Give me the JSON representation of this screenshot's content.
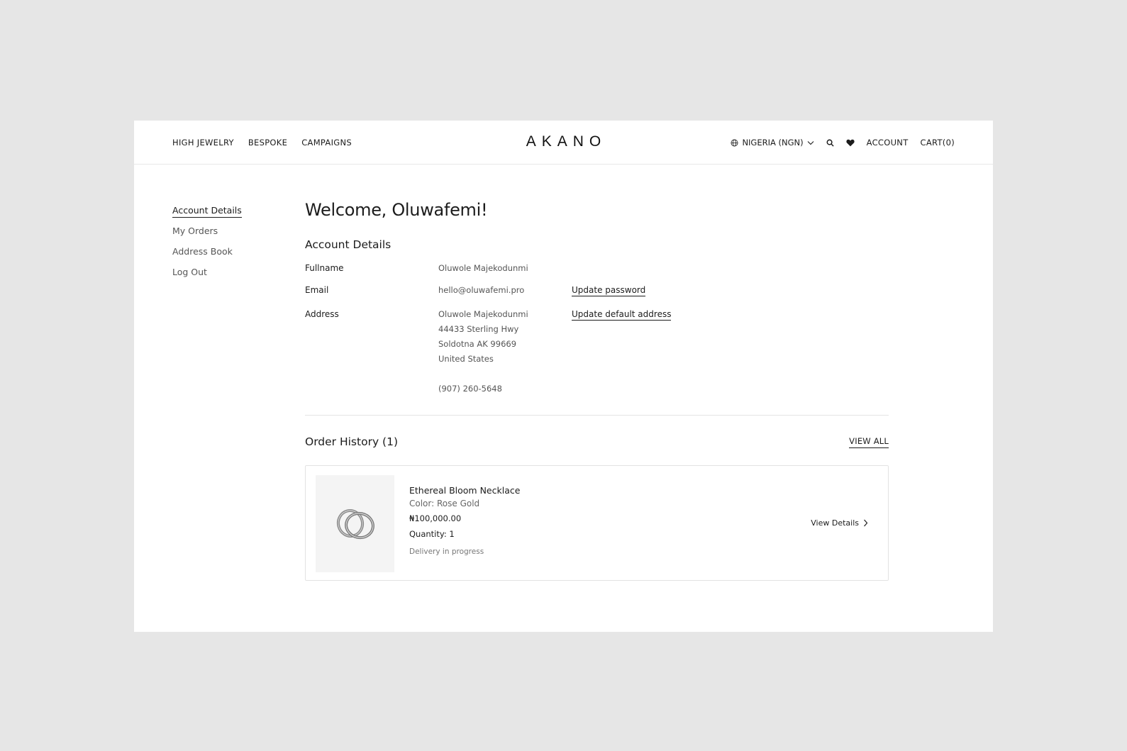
{
  "header": {
    "nav_left": [
      "HIGH JEWELRY",
      "BESPOKE",
      "CAMPAIGNS"
    ],
    "logo": "AKANO",
    "region": "NIGERIA (NGN)",
    "account": "ACCOUNT",
    "cart": "CART(0)"
  },
  "sidebar": {
    "items": [
      {
        "label": "Account Details"
      },
      {
        "label": "My Orders"
      },
      {
        "label": "Address Book"
      },
      {
        "label": "Log Out"
      }
    ]
  },
  "main": {
    "welcome": "Welcome, Oluwafemi!",
    "account_details_title": "Account Details",
    "fullname_label": "Fullname",
    "fullname_value": "Oluwole Majekodunmi",
    "email_label": "Email",
    "email_value": "hello@oluwafemi.pro",
    "update_password": "Update password",
    "address_label": "Address",
    "address_lines": [
      "Oluwole Majekodunmi",
      "44433 Sterling Hwy",
      "Soldotna AK 99669",
      "United States"
    ],
    "phone": "(907) 260-5648",
    "update_address": "Update default address",
    "order_history_title": "Order History (1)",
    "view_all": "VIEW ALL"
  },
  "order": {
    "name": "Ethereal Bloom Necklace",
    "color": "Color: Rose Gold",
    "price": "₦100,000.00",
    "quantity": "Quantity: 1",
    "status": "Delivery in progress",
    "view_details": "View Details"
  },
  "icons": {
    "globe": "globe-icon",
    "chevron": "chevron-down-icon",
    "search": "search-icon",
    "heart": "heart-icon",
    "arrow": "chevron-right-icon"
  }
}
